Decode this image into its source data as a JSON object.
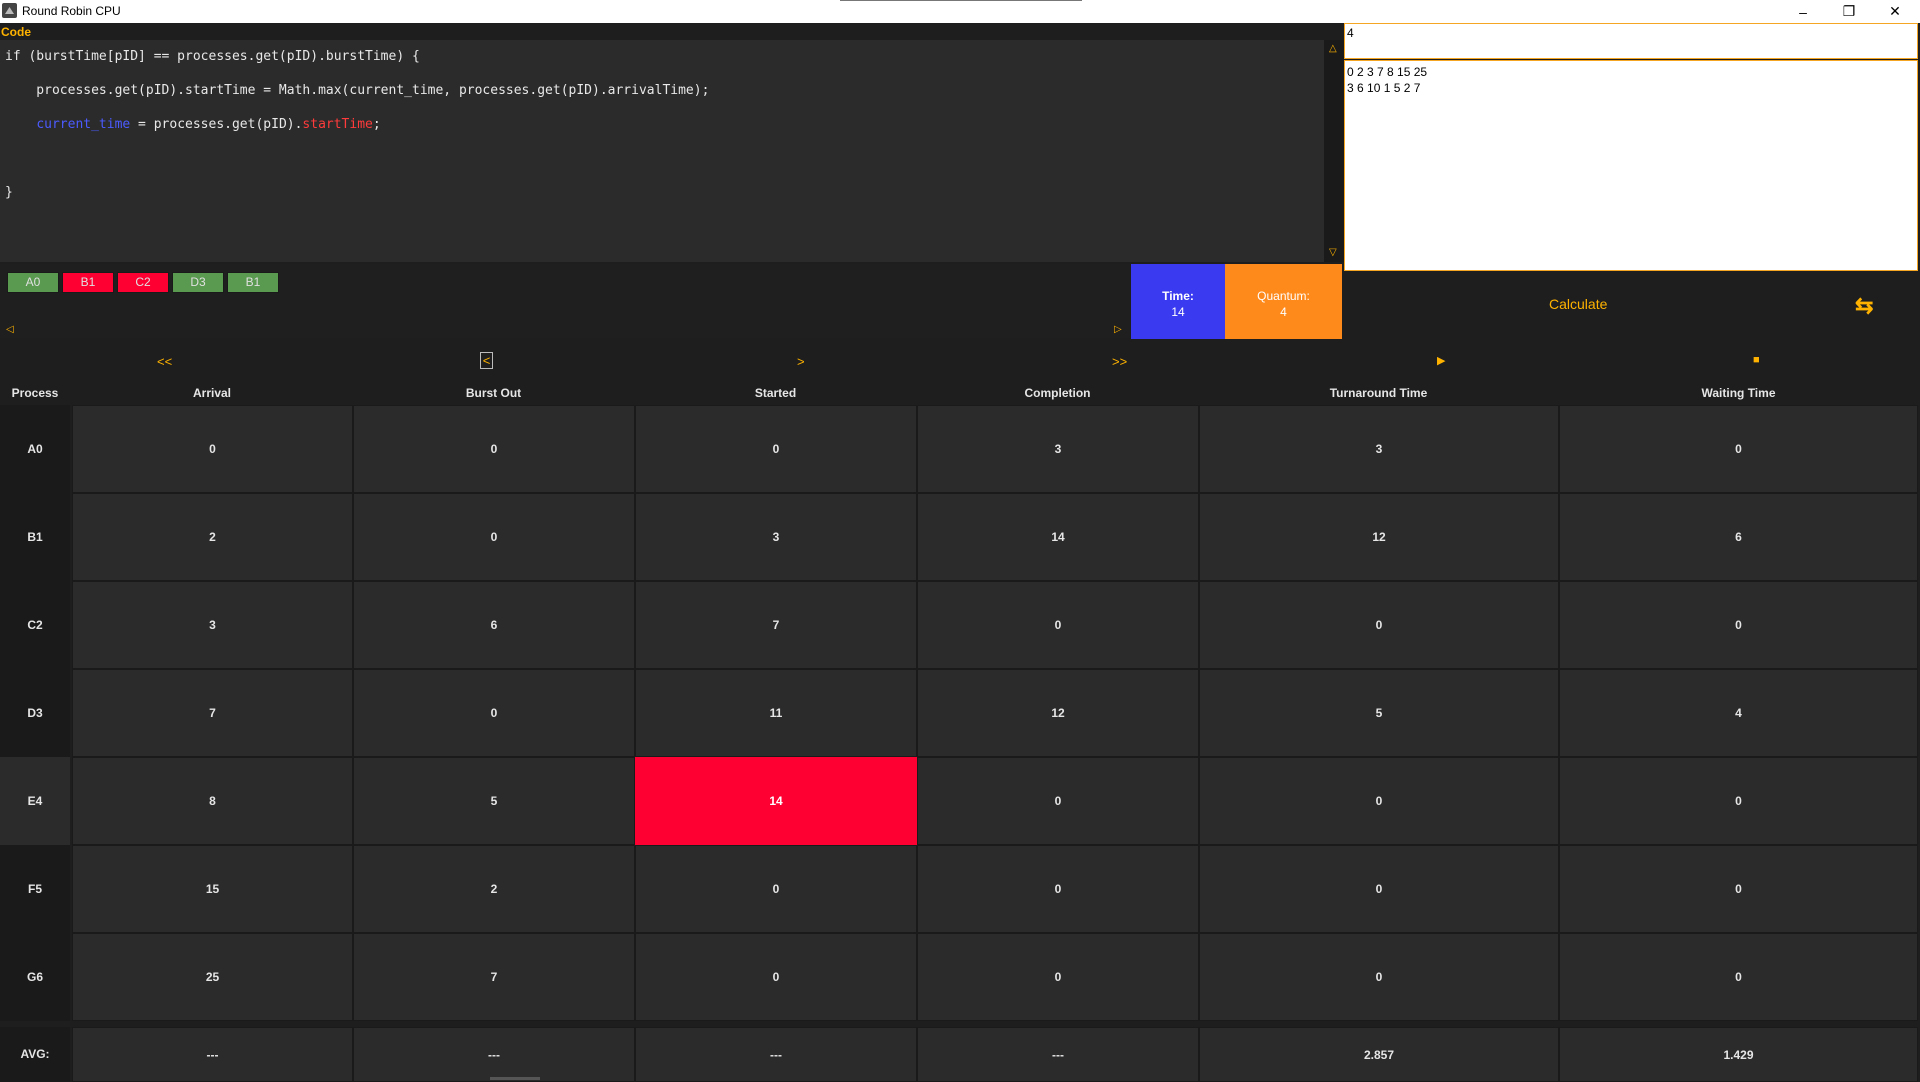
{
  "window": {
    "title": "Round Robin CPU",
    "buttons": {
      "minimize": "–",
      "restore": "❐",
      "close": "✕"
    }
  },
  "code": {
    "label": "Code",
    "lines": [
      {
        "text": "if (burstTime[pID] == processes.get(pID).burstTime) {"
      },
      {
        "text": "    processes.get(pID).startTime = Math.max(current_time, processes.get(pID).arrivalTime);"
      },
      {
        "pre": "    ",
        "blue": "current_time",
        "mid": " = processes.get(pID).",
        "red": "startTime",
        "post": ";"
      },
      {
        "text": "}"
      }
    ]
  },
  "inputs": {
    "quantum_value": "4",
    "data_lines": [
      "0 2 3 7 8 15 25",
      "3 6 10 1 5 2 7"
    ]
  },
  "gantt": {
    "chips": [
      {
        "label": "A0",
        "color": "green"
      },
      {
        "label": "B1",
        "color": "red"
      },
      {
        "label": "C2",
        "color": "red"
      },
      {
        "label": "D3",
        "color": "green"
      },
      {
        "label": "B1",
        "color": "green"
      }
    ],
    "scroll_left": "◁",
    "scroll_right": "▷"
  },
  "status": {
    "time_label": "Time:",
    "time_value": "14",
    "quantum_label": "Quantum:",
    "quantum_value": "4"
  },
  "actions": {
    "calculate": "Calculate",
    "swap_icon": "⇆"
  },
  "controls": {
    "first": "<<",
    "prev": "<",
    "next": ">",
    "last": ">>",
    "play": "▶",
    "stop": "■"
  },
  "table": {
    "headers": [
      "Process",
      "Arrival",
      "Burst Out",
      "Started",
      "Completion",
      "Turnaround Time",
      "Waiting Time"
    ],
    "rows": [
      {
        "name": "A0",
        "values": [
          "0",
          "0",
          "0",
          "3",
          "3",
          "0"
        ]
      },
      {
        "name": "B1",
        "values": [
          "2",
          "0",
          "3",
          "14",
          "12",
          "6"
        ]
      },
      {
        "name": "C2",
        "values": [
          "3",
          "6",
          "7",
          "0",
          "0",
          "0"
        ]
      },
      {
        "name": "D3",
        "values": [
          "7",
          "0",
          "11",
          "12",
          "5",
          "4"
        ]
      },
      {
        "name": "E4",
        "values": [
          "8",
          "5",
          "14",
          "0",
          "0",
          "0"
        ],
        "highlight_col": 2
      },
      {
        "name": "F5",
        "values": [
          "15",
          "2",
          "0",
          "0",
          "0",
          "0"
        ]
      },
      {
        "name": "G6",
        "values": [
          "25",
          "7",
          "0",
          "0",
          "0",
          "0"
        ]
      }
    ],
    "avg": {
      "name": "AVG:",
      "values": [
        "---",
        "---",
        "---",
        "---",
        "2.857",
        "1.429"
      ]
    }
  },
  "colors": {
    "accent": "#ffb300",
    "highlight": "#ff0033",
    "time_box": "#3a3af0",
    "quantum_box": "#ff8a1c"
  }
}
